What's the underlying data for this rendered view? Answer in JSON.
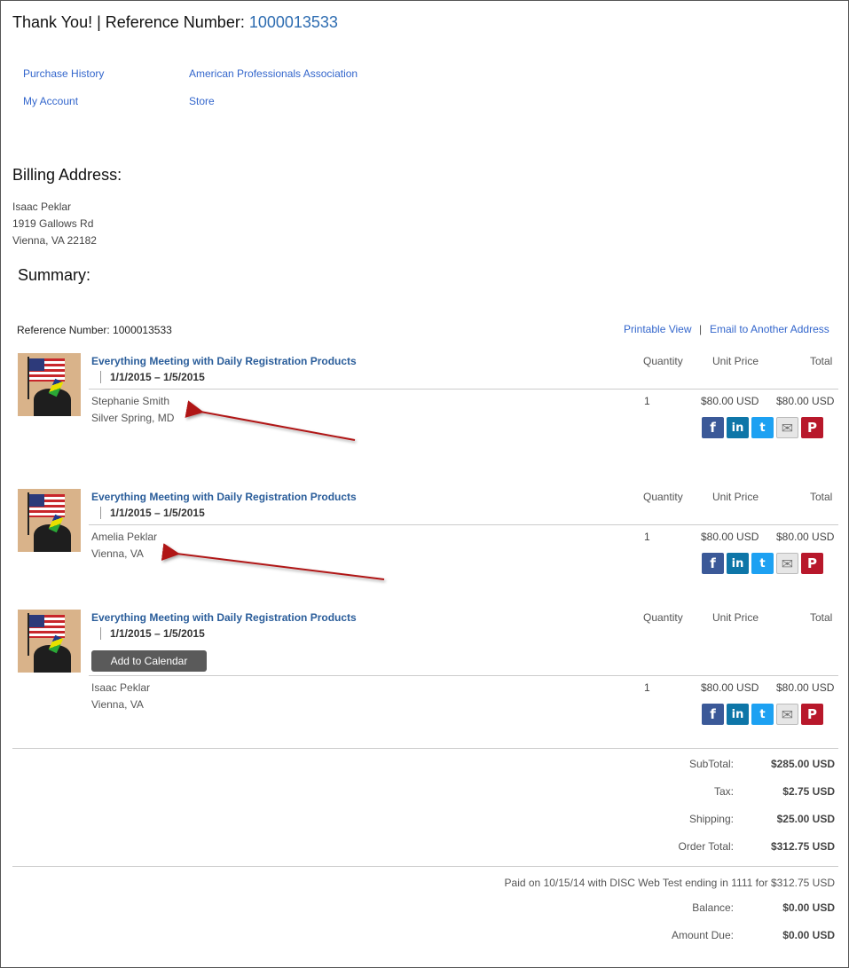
{
  "header": {
    "title_prefix": "Thank You! | Reference Number: ",
    "reference_number": "1000013533"
  },
  "nav": {
    "purchase_history": "Purchase History",
    "association": "American Professionals Association",
    "my_account": "My Account",
    "store": "Store"
  },
  "billing": {
    "heading": "Billing Address:",
    "name": "Isaac Peklar",
    "street": "1919 Gallows Rd",
    "city": "Vienna, VA 22182"
  },
  "summary": {
    "heading": "Summary:",
    "reference_label": "Reference Number: 1000013533",
    "printable_view": "Printable View",
    "separator": "|",
    "email_link": "Email to Another Address"
  },
  "columns": {
    "quantity": "Quantity",
    "unit_price": "Unit Price",
    "total": "Total"
  },
  "items": [
    {
      "title": "Everything Meeting with Daily Registration Products",
      "dates": "1/1/2015 – 1/5/2015",
      "attendee": "Stephanie Smith",
      "location": "Silver Spring, MD",
      "quantity": "1",
      "unit_price": "$80.00 USD",
      "total": "$80.00 USD"
    },
    {
      "title": "Everything Meeting with Daily Registration Products",
      "dates": "1/1/2015 – 1/5/2015",
      "attendee": "Amelia Peklar",
      "location": "Vienna, VA",
      "quantity": "1",
      "unit_price": "$80.00 USD",
      "total": "$80.00 USD"
    },
    {
      "title": "Everything Meeting with Daily Registration Products",
      "dates": "1/1/2015 – 1/5/2015",
      "calendar_button": "Add to Calendar",
      "attendee": "Isaac Peklar",
      "location": "Vienna, VA",
      "quantity": "1",
      "unit_price": "$80.00 USD",
      "total": "$80.00 USD"
    }
  ],
  "social_icons": [
    "facebook-icon",
    "linkedin-icon",
    "twitter-icon",
    "email-icon",
    "pinterest-icon"
  ],
  "social_glyphs": {
    "fb": "f",
    "li": "in",
    "tw": "t",
    "em": "✉",
    "pi": "P"
  },
  "totals": {
    "subtotal_label": "SubTotal:",
    "subtotal": "$285.00 USD",
    "tax_label": "Tax:",
    "tax": "$2.75 USD",
    "shipping_label": "Shipping:",
    "shipping": "$25.00 USD",
    "order_total_label": "Order Total:",
    "order_total": "$312.75 USD"
  },
  "payment": {
    "paid_note": "Paid on 10/15/14 with DISC Web Test ending in 1111 for $312.75 USD",
    "balance_label": "Balance:",
    "balance": "$0.00 USD",
    "amount_due_label": "Amount Due:",
    "amount_due": "$0.00 USD"
  },
  "colors": {
    "link": "#3366cc",
    "product_title": "#2a5d9a",
    "annotation_arrow": "#b01818"
  }
}
